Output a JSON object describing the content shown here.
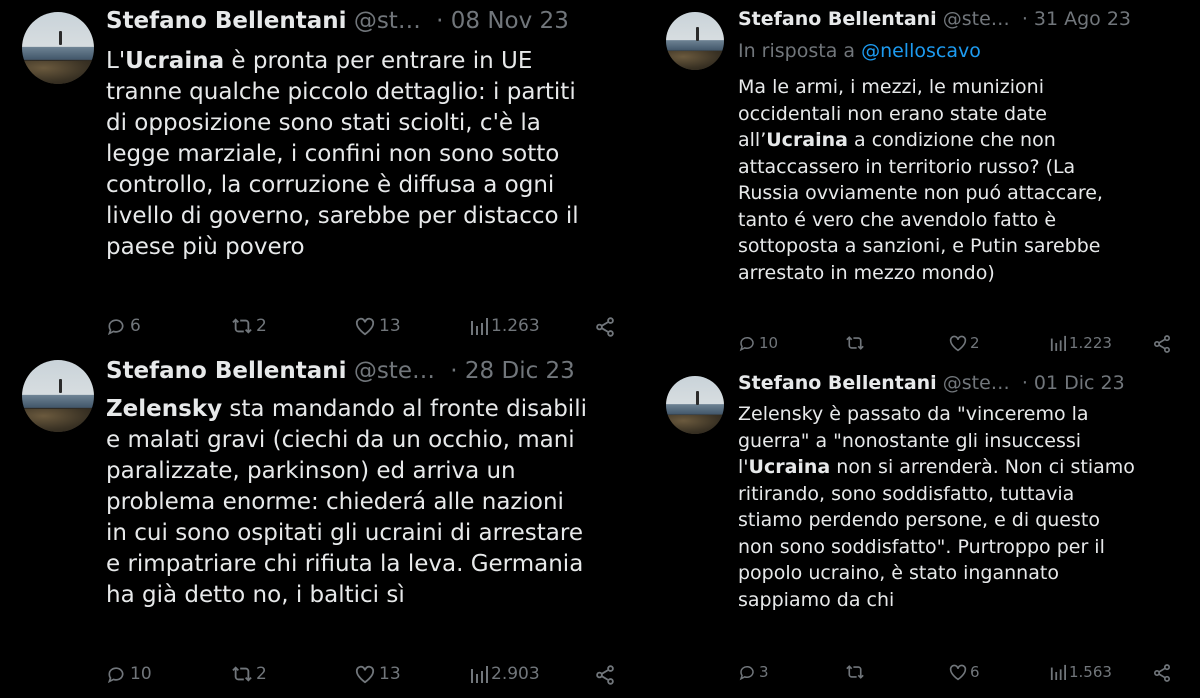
{
  "tweets": {
    "t1": {
      "name": "Stefano Bellentani",
      "handle": "@st…",
      "date": "· 08 Nov 23",
      "text_html": "L'<b>Ucraina</b> è pronta per entrare in UE<br>tranne qualche piccolo dettaglio: i partiti<br>di opposizione sono stati sciolti, c'è la<br>legge marziale, i confini non sono sotto<br>controllo, la corruzione è diffusa a ogni<br>livello di governo, sarebbe per distacco il<br>paese più povero",
      "replies": "6",
      "retweets": "2",
      "likes": "13",
      "views": "1.263"
    },
    "t2": {
      "name": "Stefano Bellentani",
      "handle": "@ste…",
      "date": "· 28 Dic 23",
      "text_html": "<b>Zelensky</b> sta mandando al fronte disabili<br>e malati gravi (ciechi da un occhio, mani<br>paralizzate, parkinson) ed arriva un<br>problema enorme: chiederá alle nazioni<br>in cui sono ospitati gli ucraini di arrestare<br>e rimpatriare chi rifiuta la leva. Germania<br>ha già detto no, i baltici sì",
      "replies": "10",
      "retweets": "2",
      "likes": "13",
      "views": "2.903"
    },
    "t3": {
      "name": "Stefano Bellentani",
      "handle": "@ste…",
      "date": "· 31 Ago 23",
      "reply_prefix": "In risposta a ",
      "reply_mention": "@nelloscavo",
      "text_html": "Ma le armi, i mezzi, le munizioni<br>occidentali non erano state date<br>all’<b>Ucraina</b> a condizione che non<br>attaccassero in territorio russo? (La<br>Russia ovviamente non puó attaccare,<br>tanto é vero che avendolo fatto è<br>sottoposta a sanzioni, e Putin sarebbe<br>arrestato in mezzo mondo)",
      "replies": "10",
      "retweets": "",
      "likes": "2",
      "views": "1.223"
    },
    "t4": {
      "name": "Stefano Bellentani",
      "handle": "@ste…",
      "date": "· 01 Dic 23",
      "text_html": "Zelensky è passato da \"vinceremo la<br>guerra\" a \"nonostante gli insuccessi<br>l'<b>Ucraina</b> non si arrenderà. Non ci stiamo<br>ritirando, sono soddisfatto, tuttavia<br>stiamo perdendo persone, e di questo<br>non sono soddisfatto\". Purtroppo per il<br>popolo ucraino, è stato ingannato<br>sappiamo da chi",
      "replies": "3",
      "retweets": "",
      "likes": "6",
      "views": "1.563"
    }
  },
  "colors": {
    "bg": "#000000",
    "text": "#e7e9ea",
    "muted": "#71767b",
    "link": "#1d9bf0"
  },
  "icons": [
    "reply-icon",
    "retweet-icon",
    "like-icon",
    "views-icon",
    "share-icon"
  ]
}
